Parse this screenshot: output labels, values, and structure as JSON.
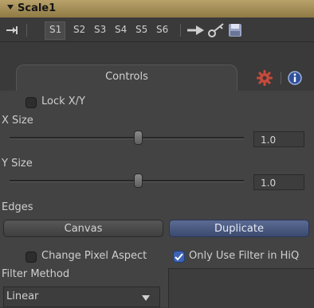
{
  "title": "Scale1",
  "toolbar": {
    "tabs": [
      "S1",
      "S2",
      "S3",
      "S4",
      "S5",
      "S6"
    ]
  },
  "tabs": {
    "controls_label": "Controls"
  },
  "controls": {
    "lock_xy_label": "Lock X/Y",
    "lock_xy_checked": false,
    "x_size_label": "X Size",
    "x_size_value": "1.0",
    "y_size_label": "Y Size",
    "y_size_value": "1.0",
    "edges_label": "Edges",
    "edges_options": [
      "Canvas",
      "Duplicate"
    ],
    "edges_selected": "Duplicate",
    "change_pixel_aspect_label": "Change Pixel Aspect",
    "change_pixel_aspect_checked": false,
    "only_use_filter_label": "Only Use Filter in HiQ",
    "only_use_filter_checked": true,
    "filter_method_label": "Filter Method",
    "filter_method_value": "Linear"
  },
  "colors": {
    "title_bar": "#a8925a",
    "accent_blue": "#4a5b85",
    "gear_red": "#c84a3a"
  }
}
